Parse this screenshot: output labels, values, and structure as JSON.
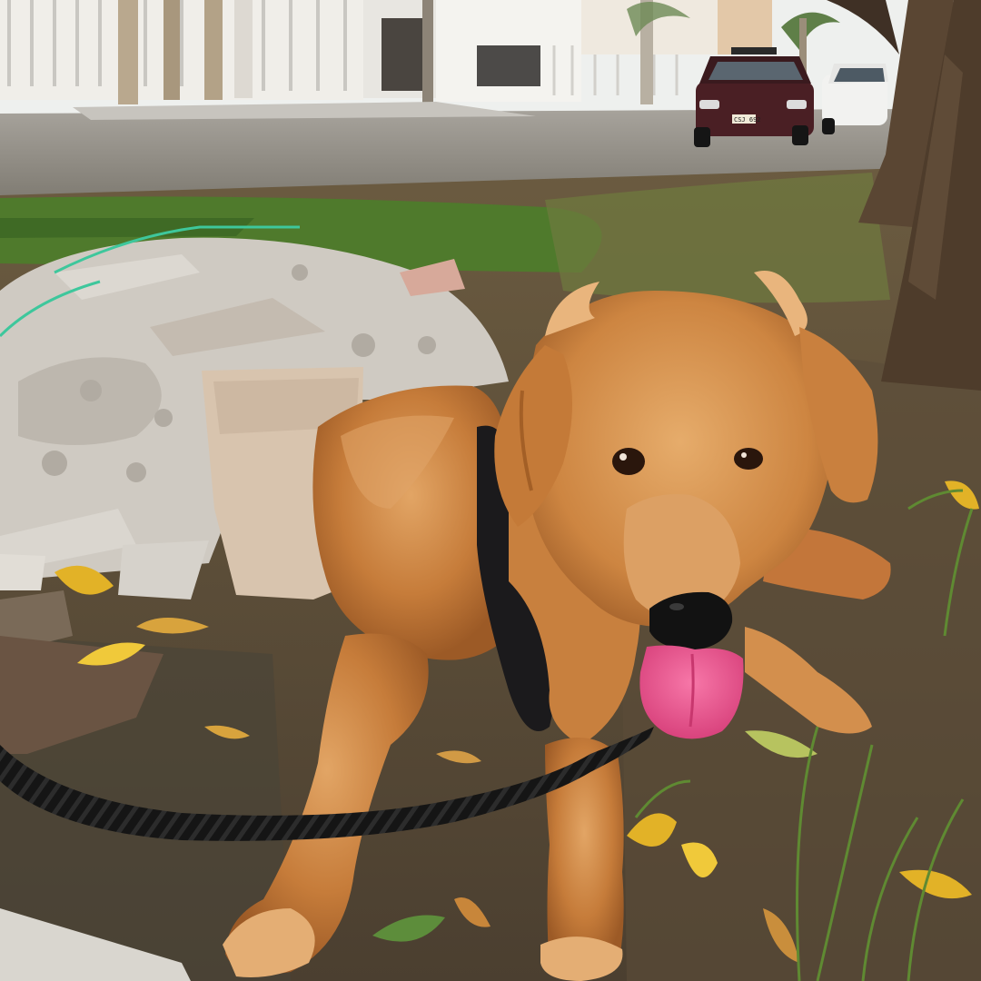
{
  "scene": {
    "description_type": "photo",
    "subject": "golden-retriever-dog",
    "setting": "residential-street-sidewalk"
  },
  "vehicles": [
    {
      "kind": "car",
      "color": "#4a1f24",
      "plate": "CSJ 692"
    },
    {
      "kind": "suv",
      "color": "#f2f2f0",
      "plate": ""
    }
  ],
  "colors": {
    "sky": "#e9eef0",
    "house_wall": "#f3f1ec",
    "road": "#8f8c86",
    "grass": "#4f7a2c",
    "dirt": "#5d4f3d",
    "rubble": "#cfcac2",
    "dog_fur": "#c9803f",
    "dog_fur_light": "#e3a868",
    "dog_fur_dark": "#8a4f22",
    "harness": "#1b1a1c",
    "tongue": "#ef5c93",
    "nose": "#121212",
    "leash": "#151515",
    "tree_bark": "#5a4633",
    "leaf_yellow": "#e2b227"
  }
}
